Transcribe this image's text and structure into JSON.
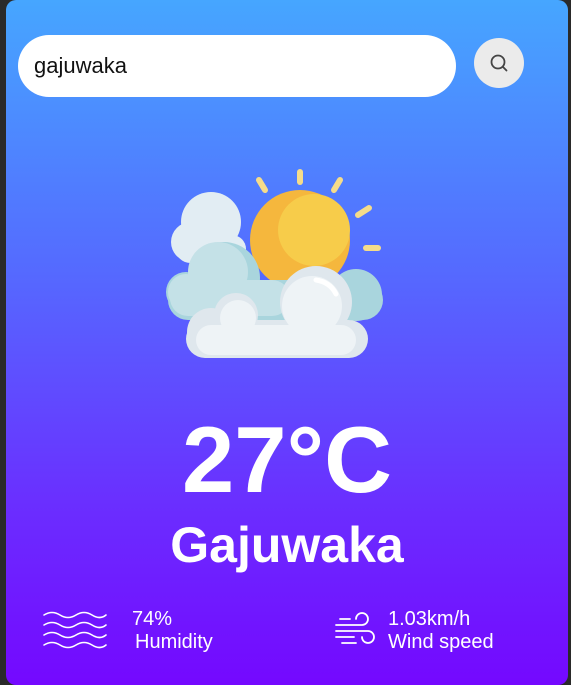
{
  "search": {
    "value": "gajuwaka",
    "icon": "search-icon"
  },
  "weather": {
    "icon": "sun-behind-clouds-icon",
    "temperature": "27°C",
    "city": "Gajuwaka"
  },
  "humidity": {
    "icon": "humidity-waves-icon",
    "value": "74%",
    "label": "Humidity"
  },
  "wind": {
    "icon": "wind-icon",
    "value": "1.03km/h",
    "label": "Wind speed"
  },
  "colors": {
    "gradient_top": "#46a6ff",
    "gradient_bottom": "#7408ff",
    "text": "#ffffff",
    "search_bg": "#ffffff",
    "button_bg": "#ebebeb"
  }
}
